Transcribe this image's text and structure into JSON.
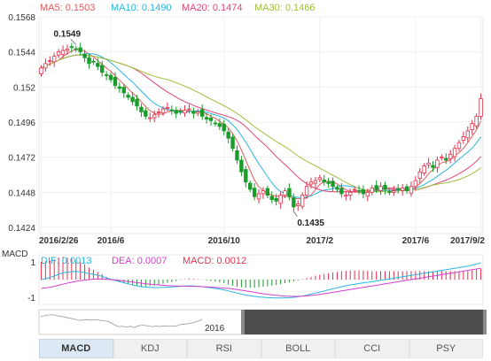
{
  "chart_data": [
    {
      "type": "candlestick",
      "legend": [
        {
          "label": "MA5: 0.1503",
          "color": "#e05d5d"
        },
        {
          "label": "MA10: 0.1490",
          "color": "#29b6e0"
        },
        {
          "label": "MA20: 0.1474",
          "color": "#e0457b"
        },
        {
          "label": "MA30: 0.1466",
          "color": "#9ec23a"
        }
      ],
      "yticks": [
        "0.1568",
        "0.1544",
        "0.152",
        "0.1496",
        "0.1472",
        "0.1448",
        "0.1424"
      ],
      "ylim": [
        0.1424,
        0.1568
      ],
      "xticks": [
        {
          "label": "2016/2/26",
          "i": 0
        },
        {
          "label": "2016/6",
          "i": 16
        },
        {
          "label": "2016/10",
          "i": 42
        },
        {
          "label": "2017/2",
          "i": 64
        },
        {
          "label": "2017/6",
          "i": 86
        },
        {
          "label": "2017/9/2",
          "i": 101
        }
      ],
      "annotations": [
        {
          "label": "0.1549",
          "i": 8,
          "value": 0.1549
        },
        {
          "label": "0.1435",
          "i": 58,
          "value": 0.1435
        }
      ],
      "up_color": "#e0314b",
      "down_color": "#1a9c2a",
      "closes": [
        0.1533,
        0.1536,
        0.1538,
        0.1541,
        0.1544,
        0.1545,
        0.1546,
        0.1547,
        0.1546,
        0.1544,
        0.154,
        0.1536,
        0.1537,
        0.1534,
        0.153,
        0.1528,
        0.1525,
        0.1521,
        0.1519,
        0.1516,
        0.1513,
        0.151,
        0.1507,
        0.1503,
        0.15,
        0.1499,
        0.1501,
        0.1503,
        0.1505,
        0.1506,
        0.1504,
        0.1502,
        0.1503,
        0.1504,
        0.1505,
        0.1502,
        0.1503,
        0.15,
        0.1498,
        0.1497,
        0.1495,
        0.1493,
        0.149,
        0.1485,
        0.1478,
        0.147,
        0.1462,
        0.1455,
        0.145,
        0.1445,
        0.1447,
        0.1449,
        0.1446,
        0.1443,
        0.1442,
        0.1446,
        0.1449,
        0.1445,
        0.1438,
        0.144,
        0.1446,
        0.1452,
        0.1455,
        0.1456,
        0.1458,
        0.1455,
        0.1454,
        0.1452,
        0.145,
        0.1447,
        0.1446,
        0.1448,
        0.145,
        0.1449,
        0.1447,
        0.1448,
        0.1451,
        0.145,
        0.1452,
        0.145,
        0.1448,
        0.1449,
        0.145,
        0.1451,
        0.1449,
        0.1452,
        0.1456,
        0.1462,
        0.1466,
        0.1468,
        0.1465,
        0.147,
        0.1472,
        0.147,
        0.1474,
        0.1478,
        0.1482,
        0.1486,
        0.149,
        0.1495,
        0.15,
        0.1512
      ]
    },
    {
      "type": "line",
      "name": "MACD",
      "legend": [
        {
          "label": "DIF: 0.0013",
          "color": "#29b6e0"
        },
        {
          "label": "DEA: 0.0007",
          "color": "#d63fd0"
        },
        {
          "label": "MACD: 0.0012",
          "color": "#e0314b"
        }
      ],
      "yticks": [
        "1",
        "-1"
      ],
      "ylim": [
        -1.25,
        1.25
      ],
      "dif": [
        0.0,
        0.05,
        0.12,
        0.2,
        0.3,
        0.38,
        0.42,
        0.45,
        0.46,
        0.44,
        0.4,
        0.34,
        0.3,
        0.25,
        0.18,
        0.1,
        0.02,
        -0.05,
        -0.12,
        -0.18,
        -0.24,
        -0.3,
        -0.35,
        -0.4,
        -0.42,
        -0.44,
        -0.45,
        -0.45,
        -0.44,
        -0.43,
        -0.42,
        -0.4,
        -0.38,
        -0.36,
        -0.35,
        -0.36,
        -0.38,
        -0.4,
        -0.43,
        -0.46,
        -0.5,
        -0.54,
        -0.58,
        -0.64,
        -0.7,
        -0.76,
        -0.82,
        -0.87,
        -0.91,
        -0.95,
        -0.98,
        -1.0,
        -1.02,
        -1.03,
        -1.04,
        -1.04,
        -1.03,
        -1.02,
        -1.0,
        -0.97,
        -0.93,
        -0.88,
        -0.82,
        -0.76,
        -0.7,
        -0.64,
        -0.58,
        -0.52,
        -0.46,
        -0.4,
        -0.35,
        -0.3,
        -0.26,
        -0.22,
        -0.18,
        -0.15,
        -0.12,
        -0.08,
        -0.04,
        0.0,
        0.04,
        0.08,
        0.12,
        0.16,
        0.2,
        0.24,
        0.28,
        0.32,
        0.36,
        0.4,
        0.44,
        0.48,
        0.52,
        0.56,
        0.6,
        0.64,
        0.68,
        0.72,
        0.76,
        0.82,
        0.88,
        0.95
      ],
      "dea": [
        -0.5,
        -0.47,
        -0.43,
        -0.38,
        -0.32,
        -0.26,
        -0.2,
        -0.15,
        -0.1,
        -0.06,
        -0.03,
        0.0,
        0.02,
        0.03,
        0.03,
        0.02,
        0.0,
        -0.02,
        -0.05,
        -0.08,
        -0.11,
        -0.14,
        -0.17,
        -0.2,
        -0.23,
        -0.26,
        -0.28,
        -0.3,
        -0.32,
        -0.34,
        -0.35,
        -0.36,
        -0.37,
        -0.37,
        -0.38,
        -0.38,
        -0.39,
        -0.4,
        -0.41,
        -0.42,
        -0.44,
        -0.46,
        -0.48,
        -0.5,
        -0.53,
        -0.56,
        -0.6,
        -0.64,
        -0.68,
        -0.72,
        -0.76,
        -0.8,
        -0.83,
        -0.86,
        -0.89,
        -0.91,
        -0.93,
        -0.94,
        -0.95,
        -0.95,
        -0.94,
        -0.92,
        -0.9,
        -0.87,
        -0.84,
        -0.8,
        -0.76,
        -0.72,
        -0.68,
        -0.64,
        -0.6,
        -0.56,
        -0.52,
        -0.48,
        -0.44,
        -0.4,
        -0.36,
        -0.32,
        -0.28,
        -0.24,
        -0.2,
        -0.16,
        -0.12,
        -0.08,
        -0.04,
        0.0,
        0.04,
        0.08,
        0.12,
        0.16,
        0.2,
        0.24,
        0.28,
        0.32,
        0.36,
        0.4,
        0.44,
        0.48,
        0.52,
        0.56,
        0.6,
        0.64
      ]
    }
  ],
  "macd_label": "MACD",
  "navigator": {
    "label": "2016"
  },
  "tabs": [
    "MACD",
    "KDJ",
    "RSI",
    "BOLL",
    "CCI",
    "PSY"
  ],
  "active_tab": "MACD"
}
